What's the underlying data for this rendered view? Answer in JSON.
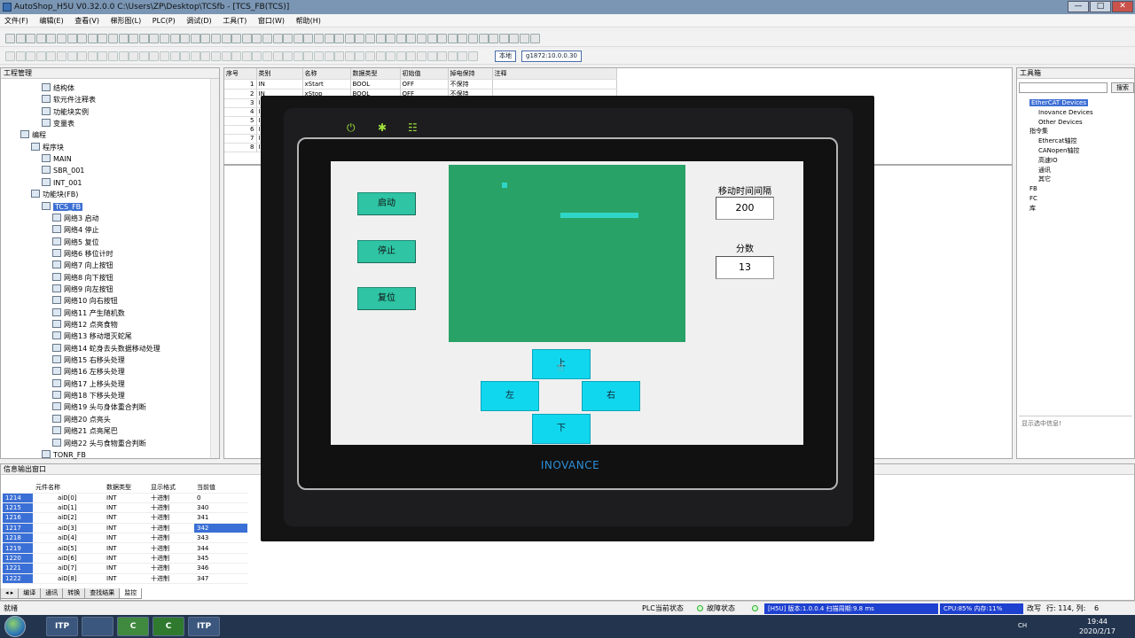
{
  "window": {
    "title": "AutoShop_H5U V0.32.0.0  C:\\Users\\ZP\\Desktop\\TCSfb - [TCS_FB(TCS)]",
    "minimize": "—",
    "maximize": "□",
    "close": "✕"
  },
  "menu": [
    "文件(F)",
    "编辑(E)",
    "查看(V)",
    "梯形图(L)",
    "PLC(P)",
    "调试(D)",
    "工具(T)",
    "窗口(W)",
    "帮助(H)"
  ],
  "toolbar": {
    "local_label": "本地",
    "ip_label": "g1872:10.0.0.30"
  },
  "project_panel": {
    "title": "工程管理",
    "items": [
      {
        "label": "结构体",
        "indent": 3
      },
      {
        "label": "软元件注释表",
        "indent": 3
      },
      {
        "label": "功能块实例",
        "indent": 3
      },
      {
        "label": "变量表",
        "indent": 3
      },
      {
        "label": "编程",
        "indent": 1
      },
      {
        "label": "程序块",
        "indent": 2
      },
      {
        "label": "MAIN",
        "indent": 3
      },
      {
        "label": "SBR_001",
        "indent": 3
      },
      {
        "label": "INT_001",
        "indent": 3
      },
      {
        "label": "功能块(FB)",
        "indent": 2
      },
      {
        "label": "TCS_FB",
        "indent": 3,
        "selected": true
      },
      {
        "label": "网络3 启动",
        "indent": 4
      },
      {
        "label": "网络4 停止",
        "indent": 4
      },
      {
        "label": "网络5 复位",
        "indent": 4
      },
      {
        "label": "网络6 移位计时",
        "indent": 4
      },
      {
        "label": "网络7 向上按钮",
        "indent": 4
      },
      {
        "label": "网络8 向下按钮",
        "indent": 4
      },
      {
        "label": "网络9 向左按钮",
        "indent": 4
      },
      {
        "label": "网络10 向右按钮",
        "indent": 4
      },
      {
        "label": "网络11 产生随机数",
        "indent": 4
      },
      {
        "label": "网络12 点亮食物",
        "indent": 4
      },
      {
        "label": "网络13 移动增灭蛇尾",
        "indent": 4
      },
      {
        "label": "网络14 蛇身去头数据移动处理",
        "indent": 4
      },
      {
        "label": "网络15 右移头处理",
        "indent": 4
      },
      {
        "label": "网络16 左移头处理",
        "indent": 4
      },
      {
        "label": "网络17 上移头处理",
        "indent": 4
      },
      {
        "label": "网络18 下移头处理",
        "indent": 4
      },
      {
        "label": "网络19 头与身体重合判断",
        "indent": 4
      },
      {
        "label": "网络20 点亮头",
        "indent": 4
      },
      {
        "label": "网络21 点亮尾巴",
        "indent": 4
      },
      {
        "label": "网络22 头与食物重合判断",
        "indent": 4
      },
      {
        "label": "TONR_FB",
        "indent": 3
      }
    ]
  },
  "var_table": {
    "headers": [
      "序号",
      "类别",
      "名称",
      "数据类型",
      "初始值",
      "掉电保持",
      "注释"
    ],
    "rows": [
      [
        "1",
        "IN",
        "xStart",
        "BOOL",
        "OFF",
        "不保持",
        ""
      ],
      [
        "2",
        "IN",
        "xStop",
        "BOOL",
        "OFF",
        "不保持",
        ""
      ],
      [
        "3",
        "I",
        "",
        "",
        "",
        "",
        ""
      ],
      [
        "4",
        "I",
        "",
        "",
        "",
        "",
        ""
      ],
      [
        "5",
        "I",
        "",
        "",
        "",
        "",
        ""
      ],
      [
        "6",
        "I",
        "",
        "",
        "",
        "",
        ""
      ],
      [
        "7",
        "I",
        "",
        "",
        "",
        "",
        ""
      ],
      [
        "8",
        "I",
        "",
        "",
        "",
        "",
        ""
      ]
    ]
  },
  "toolbox": {
    "title": "工具箱",
    "search_label": "搜索",
    "items": [
      {
        "label": "EtherCAT Devices",
        "indent": 1,
        "selected": true
      },
      {
        "label": "Inovance Devices",
        "indent": 2
      },
      {
        "label": "Other Devices",
        "indent": 2
      },
      {
        "label": "指令集",
        "indent": 1
      },
      {
        "label": "Ethercat轴控",
        "indent": 2
      },
      {
        "label": "CANopen轴控",
        "indent": 2
      },
      {
        "label": "高速IO",
        "indent": 2
      },
      {
        "label": "通讯",
        "indent": 2
      },
      {
        "label": "其它",
        "indent": 2
      },
      {
        "label": "FB",
        "indent": 1
      },
      {
        "label": "FC",
        "indent": 1
      },
      {
        "label": "库",
        "indent": 1
      }
    ],
    "info_placeholder": "显示选中信息!"
  },
  "output_panel": {
    "title": "信息输出窗口",
    "headers": [
      "",
      "元件名称",
      "数据类型",
      "显示格式",
      "当前值"
    ],
    "rows": [
      [
        "1214",
        "aiD[0]",
        "INT",
        "十进制",
        "0"
      ],
      [
        "1215",
        "aiD[1]",
        "INT",
        "十进制",
        "340"
      ],
      [
        "1216",
        "aiD[2]",
        "INT",
        "十进制",
        "341"
      ],
      [
        "1217",
        "aiD[3]",
        "INT",
        "十进制",
        "342"
      ],
      [
        "1218",
        "aiD[4]",
        "INT",
        "十进制",
        "343"
      ],
      [
        "1219",
        "aiD[5]",
        "INT",
        "十进制",
        "344"
      ],
      [
        "1220",
        "aiD[6]",
        "INT",
        "十进制",
        "345"
      ],
      [
        "1221",
        "aiD[7]",
        "INT",
        "十进制",
        "346"
      ],
      [
        "1222",
        "aiD[8]",
        "INT",
        "十进制",
        "347"
      ]
    ],
    "tabs": [
      "编译",
      "通讯",
      "转换",
      "查找结果",
      "监控"
    ]
  },
  "status": {
    "ready": "就绪",
    "plc_state_label": "PLC当前状态",
    "fault_label": "故障状态",
    "version": "[H5U] 版本:1.0.0.4 扫描周期:9.8 ms",
    "cpu": "CPU:85%  内存:11%",
    "mode": "改写",
    "row_col": "行: 114, 列:",
    "col_val": "6"
  },
  "taskbar": {
    "apps": [
      "ITP",
      "",
      "C",
      "C",
      "ITP"
    ],
    "time": "19:44",
    "date": "2020/2/17",
    "lang": "CH"
  },
  "hmi": {
    "brand": "INOVANCE",
    "start_label": "启动",
    "stop_label": "停止",
    "reset_label": "复位",
    "interval_label": "移动时间间隔",
    "interval_value": "200",
    "score_label": "分数",
    "score_value": "13",
    "up_label": "上",
    "down_label": "下",
    "left_label": "左",
    "right_label": "右",
    "colors": {
      "game_bg": "#29a267",
      "snake": "#2fd6c8",
      "button": "#2ec4a4",
      "dir_button": "#11d7ee"
    }
  }
}
